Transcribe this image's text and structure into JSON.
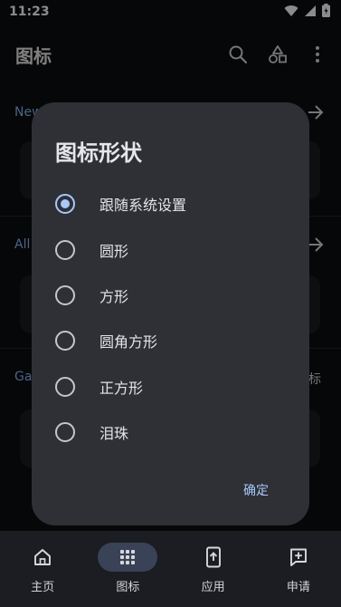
{
  "status_bar": {
    "time": "11:23"
  },
  "app_bar": {
    "title": "图标"
  },
  "background": {
    "section1_title": "New",
    "section2_title": "All",
    "section3_title": "Ga",
    "section3_peek": "标"
  },
  "dialog": {
    "title": "图标形状",
    "options": [
      {
        "label": "跟随系统设置",
        "selected": true
      },
      {
        "label": "圆形",
        "selected": false
      },
      {
        "label": "方形",
        "selected": false
      },
      {
        "label": "圆角方形",
        "selected": false
      },
      {
        "label": "正方形",
        "selected": false
      },
      {
        "label": "泪珠",
        "selected": false
      }
    ],
    "confirm_label": "确定"
  },
  "bottom_nav": {
    "items": [
      {
        "label": "主页",
        "icon": "home-icon",
        "active": false
      },
      {
        "label": "图标",
        "icon": "apps-grid-icon",
        "active": true
      },
      {
        "label": "应用",
        "icon": "app-upload-icon",
        "active": false
      },
      {
        "label": "申请",
        "icon": "request-add-icon",
        "active": false
      }
    ]
  },
  "colors": {
    "accent": "#a8c7fa",
    "dialog_bg": "#2e3036",
    "page_bg": "#0c0d10"
  }
}
